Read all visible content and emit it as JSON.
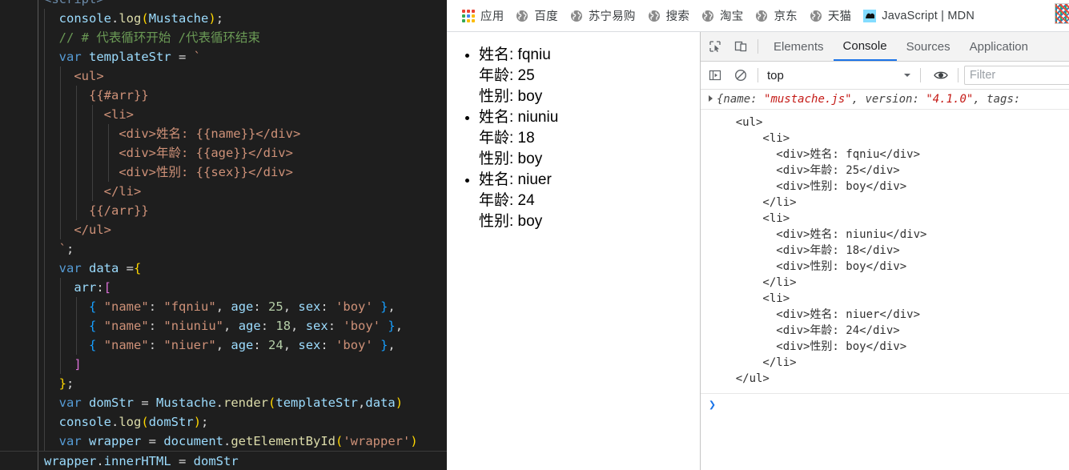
{
  "editor": {
    "lines": [
      {
        "indent": 0,
        "tokens": [
          {
            "t": "<script>",
            "c": "dim"
          }
        ],
        "clipped": true
      },
      {
        "indent": 1,
        "tokens": [
          {
            "t": "console",
            "c": "obj"
          },
          {
            "t": ".",
            "c": "punc"
          },
          {
            "t": "log",
            "c": "fn"
          },
          {
            "t": "(",
            "c": "par-y"
          },
          {
            "t": "Mustache",
            "c": "obj"
          },
          {
            "t": ")",
            "c": "par-y"
          },
          {
            "t": ";",
            "c": "punc"
          }
        ]
      },
      {
        "indent": 1,
        "tokens": [
          {
            "t": "// # 代表循环开始 /代表循环结束",
            "c": "com"
          }
        ]
      },
      {
        "indent": 1,
        "tokens": [
          {
            "t": "var",
            "c": "kw"
          },
          {
            "t": " ",
            "c": "plain"
          },
          {
            "t": "templateStr",
            "c": "obj"
          },
          {
            "t": " = ",
            "c": "punc"
          },
          {
            "t": "`",
            "c": "str"
          }
        ]
      },
      {
        "indent": 2,
        "tokens": [
          {
            "t": "<ul>",
            "c": "str"
          }
        ]
      },
      {
        "indent": 3,
        "tokens": [
          {
            "t": "{{#arr}}",
            "c": "str"
          }
        ]
      },
      {
        "indent": 4,
        "tokens": [
          {
            "t": "<li>",
            "c": "str"
          }
        ]
      },
      {
        "indent": 5,
        "tokens": [
          {
            "t": "<div>姓名: {{name}}</div>",
            "c": "str"
          }
        ]
      },
      {
        "indent": 5,
        "tokens": [
          {
            "t": "<div>年龄: {{age}}</div>",
            "c": "str"
          }
        ]
      },
      {
        "indent": 5,
        "tokens": [
          {
            "t": "<div>性别: {{sex}}</div>",
            "c": "str"
          }
        ]
      },
      {
        "indent": 4,
        "tokens": [
          {
            "t": "</li>",
            "c": "str"
          }
        ]
      },
      {
        "indent": 3,
        "tokens": [
          {
            "t": "{{/arr}}",
            "c": "str"
          }
        ]
      },
      {
        "indent": 2,
        "tokens": [
          {
            "t": "</ul>",
            "c": "str"
          }
        ]
      },
      {
        "indent": 1,
        "tokens": [
          {
            "t": "`",
            "c": "str"
          },
          {
            "t": ";",
            "c": "punc"
          }
        ]
      },
      {
        "indent": 1,
        "tokens": [
          {
            "t": "var",
            "c": "kw"
          },
          {
            "t": " ",
            "c": "plain"
          },
          {
            "t": "data",
            "c": "obj"
          },
          {
            "t": " =",
            "c": "punc"
          },
          {
            "t": "{",
            "c": "par-y"
          }
        ]
      },
      {
        "indent": 2,
        "tokens": [
          {
            "t": "arr",
            "c": "obj"
          },
          {
            "t": ":",
            "c": "punc"
          },
          {
            "t": "[",
            "c": "par-p"
          }
        ]
      },
      {
        "indent": 3,
        "tokens": [
          {
            "t": "{",
            "c": "par-b"
          },
          {
            "t": " ",
            "c": "plain"
          },
          {
            "t": "\"name\"",
            "c": "str"
          },
          {
            "t": ": ",
            "c": "punc"
          },
          {
            "t": "\"fqniu\"",
            "c": "str"
          },
          {
            "t": ", ",
            "c": "punc"
          },
          {
            "t": "age",
            "c": "obj"
          },
          {
            "t": ": ",
            "c": "punc"
          },
          {
            "t": "25",
            "c": "num"
          },
          {
            "t": ", ",
            "c": "punc"
          },
          {
            "t": "sex",
            "c": "obj"
          },
          {
            "t": ": ",
            "c": "punc"
          },
          {
            "t": "'boy'",
            "c": "str"
          },
          {
            "t": " ",
            "c": "plain"
          },
          {
            "t": "}",
            "c": "par-b"
          },
          {
            "t": ",",
            "c": "punc"
          }
        ]
      },
      {
        "indent": 3,
        "tokens": [
          {
            "t": "{",
            "c": "par-b"
          },
          {
            "t": " ",
            "c": "plain"
          },
          {
            "t": "\"name\"",
            "c": "str"
          },
          {
            "t": ": ",
            "c": "punc"
          },
          {
            "t": "\"niuniu\"",
            "c": "str"
          },
          {
            "t": ", ",
            "c": "punc"
          },
          {
            "t": "age",
            "c": "obj"
          },
          {
            "t": ": ",
            "c": "punc"
          },
          {
            "t": "18",
            "c": "num"
          },
          {
            "t": ", ",
            "c": "punc"
          },
          {
            "t": "sex",
            "c": "obj"
          },
          {
            "t": ": ",
            "c": "punc"
          },
          {
            "t": "'boy'",
            "c": "str"
          },
          {
            "t": " ",
            "c": "plain"
          },
          {
            "t": "}",
            "c": "par-b"
          },
          {
            "t": ",",
            "c": "punc"
          }
        ]
      },
      {
        "indent": 3,
        "tokens": [
          {
            "t": "{",
            "c": "par-b"
          },
          {
            "t": " ",
            "c": "plain"
          },
          {
            "t": "\"name\"",
            "c": "str"
          },
          {
            "t": ": ",
            "c": "punc"
          },
          {
            "t": "\"niuer\"",
            "c": "str"
          },
          {
            "t": ", ",
            "c": "punc"
          },
          {
            "t": "age",
            "c": "obj"
          },
          {
            "t": ": ",
            "c": "punc"
          },
          {
            "t": "24",
            "c": "num"
          },
          {
            "t": ", ",
            "c": "punc"
          },
          {
            "t": "sex",
            "c": "obj"
          },
          {
            "t": ": ",
            "c": "punc"
          },
          {
            "t": "'boy'",
            "c": "str"
          },
          {
            "t": " ",
            "c": "plain"
          },
          {
            "t": "}",
            "c": "par-b"
          },
          {
            "t": ",",
            "c": "punc"
          }
        ]
      },
      {
        "indent": 2,
        "tokens": [
          {
            "t": "]",
            "c": "par-p"
          }
        ]
      },
      {
        "indent": 1,
        "tokens": [
          {
            "t": "}",
            "c": "par-y"
          },
          {
            "t": ";",
            "c": "punc"
          }
        ]
      },
      {
        "indent": 1,
        "tokens": [
          {
            "t": "var",
            "c": "kw"
          },
          {
            "t": " ",
            "c": "plain"
          },
          {
            "t": "domStr",
            "c": "obj"
          },
          {
            "t": " = ",
            "c": "punc"
          },
          {
            "t": "Mustache",
            "c": "obj"
          },
          {
            "t": ".",
            "c": "punc"
          },
          {
            "t": "render",
            "c": "fn"
          },
          {
            "t": "(",
            "c": "par-y"
          },
          {
            "t": "templateStr",
            "c": "obj"
          },
          {
            "t": ",",
            "c": "punc"
          },
          {
            "t": "data",
            "c": "obj"
          },
          {
            "t": ")",
            "c": "par-y"
          }
        ]
      },
      {
        "indent": 1,
        "tokens": [
          {
            "t": "console",
            "c": "obj"
          },
          {
            "t": ".",
            "c": "punc"
          },
          {
            "t": "log",
            "c": "fn"
          },
          {
            "t": "(",
            "c": "par-y"
          },
          {
            "t": "domStr",
            "c": "obj"
          },
          {
            "t": ")",
            "c": "par-y"
          },
          {
            "t": ";",
            "c": "punc"
          }
        ]
      },
      {
        "indent": 1,
        "tokens": [
          {
            "t": "var",
            "c": "kw"
          },
          {
            "t": " ",
            "c": "plain"
          },
          {
            "t": "wrapper",
            "c": "obj"
          },
          {
            "t": " = ",
            "c": "punc"
          },
          {
            "t": "document",
            "c": "obj"
          },
          {
            "t": ".",
            "c": "punc"
          },
          {
            "t": "getElementById",
            "c": "fn"
          },
          {
            "t": "(",
            "c": "par-y"
          },
          {
            "t": "'wrapper'",
            "c": "str"
          },
          {
            "t": ")",
            "c": "par-y"
          }
        ]
      },
      {
        "indent": 0,
        "tokens": [
          {
            "t": "wrapper",
            "c": "obj"
          },
          {
            "t": ".",
            "c": "punc"
          },
          {
            "t": "innerHTML",
            "c": "obj"
          },
          {
            "t": " = ",
            "c": "punc"
          },
          {
            "t": "domStr",
            "c": "obj"
          }
        ],
        "current": true
      }
    ]
  },
  "browser": {
    "bookmarks": [
      {
        "label": "应用",
        "icon": "apps-grid-icon"
      },
      {
        "label": "百度",
        "icon": "globe-icon"
      },
      {
        "label": "苏宁易购",
        "icon": "globe-icon"
      },
      {
        "label": "搜索",
        "icon": "globe-icon"
      },
      {
        "label": "淘宝",
        "icon": "globe-icon"
      },
      {
        "label": "京东",
        "icon": "globe-icon"
      },
      {
        "label": "天猫",
        "icon": "globe-icon"
      },
      {
        "label": "JavaScript | MDN",
        "icon": "mdn-icon"
      }
    ],
    "page": {
      "items": [
        {
          "name_label": "姓名:",
          "name": "fqniu",
          "age_label": "年龄:",
          "age": "25",
          "sex_label": "性别:",
          "sex": "boy"
        },
        {
          "name_label": "姓名:",
          "name": "niuniu",
          "age_label": "年龄:",
          "age": "18",
          "sex_label": "性别:",
          "sex": "boy"
        },
        {
          "name_label": "姓名:",
          "name": "niuer",
          "age_label": "年龄:",
          "age": "24",
          "sex_label": "性别:",
          "sex": "boy"
        }
      ]
    }
  },
  "devtools": {
    "tabs": [
      {
        "label": "Elements",
        "active": false
      },
      {
        "label": "Console",
        "active": true
      },
      {
        "label": "Sources",
        "active": false
      },
      {
        "label": "Application",
        "active": false
      }
    ],
    "toolbar": {
      "context_value": "top",
      "filter_placeholder": "Filter"
    },
    "console": {
      "object_line": {
        "prefix": "{name: ",
        "value1": "\"mustache.js\"",
        "mid": ", version: ",
        "value2": "\"4.1.0\"",
        "suffix": ", tags:"
      },
      "html_output": "    <ul>\n        <li>\n          <div>姓名: fqniu</div>\n          <div>年龄: 25</div>\n          <div>性别: boy</div>\n        </li>\n        <li>\n          <div>姓名: niuniu</div>\n          <div>年龄: 18</div>\n          <div>性别: boy</div>\n        </li>\n        <li>\n          <div>姓名: niuer</div>\n          <div>年龄: 24</div>\n          <div>性别: boy</div>\n        </li>\n    </ul>",
      "prompt_caret": "❯"
    }
  },
  "colors": {
    "editor_bg": "#1e1e1e",
    "accent": "#1a73e8",
    "string": "#ce9178",
    "keyword": "#569cd6",
    "comment": "#6a9955",
    "console_string": "#c41a16"
  }
}
